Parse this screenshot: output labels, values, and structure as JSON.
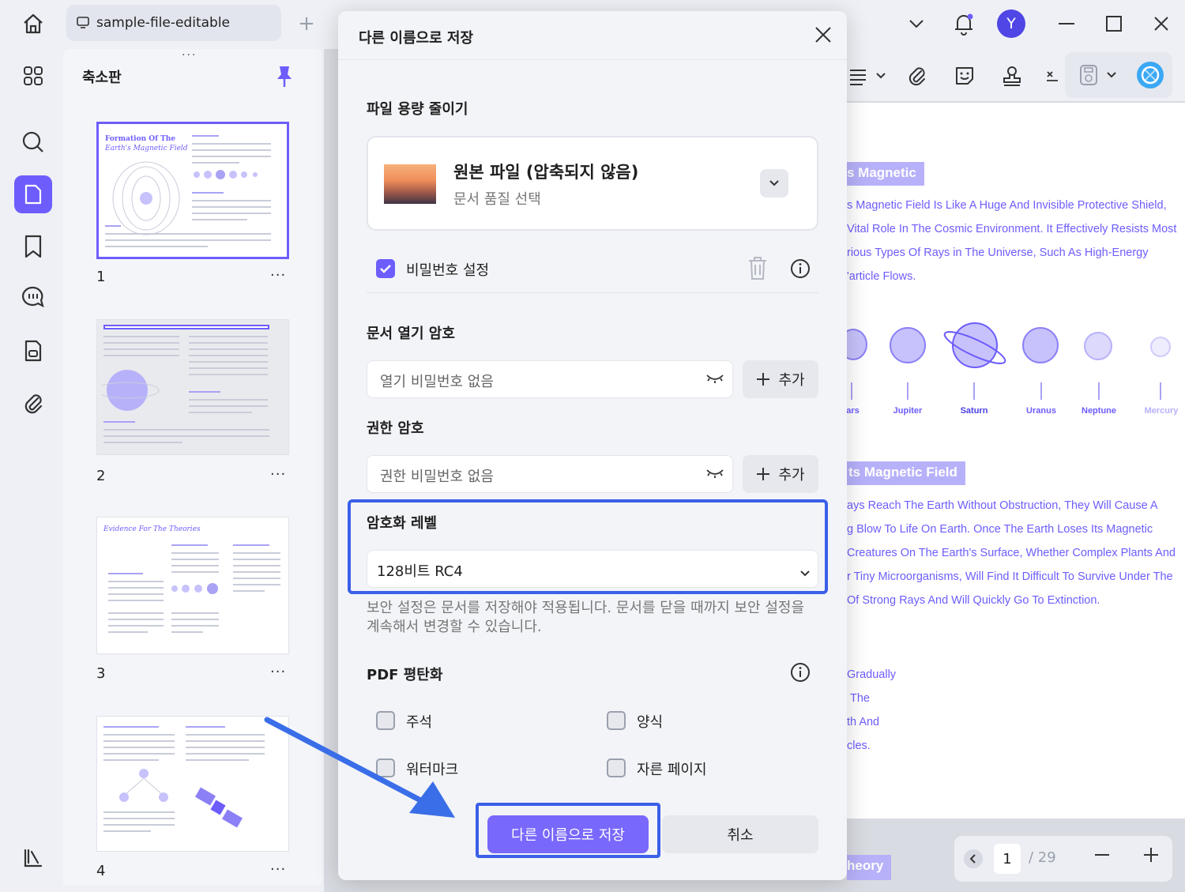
{
  "tab": {
    "title": "sample-file-editable"
  },
  "avatar_letter": "Y",
  "thumbnails": {
    "title": "축소판",
    "pages": [
      {
        "number": "1",
        "heading": "Formation Of The",
        "subheading": "Earth's Magnetic Field"
      },
      {
        "number": "2"
      },
      {
        "number": "3",
        "heading": "Evidence For The Theories"
      },
      {
        "number": "4"
      }
    ]
  },
  "document": {
    "heading1": "s Magnetic",
    "lines1": [
      "s Magnetic Field Is Like A Huge And Invisible Protective Shield,",
      "Vital Role In The Cosmic Environment. It Effectively Resists Most",
      "rious Types Of Rays in The Universe, Such As High-Energy",
      "'article Flows."
    ],
    "planets": [
      "lars",
      "Jupiter",
      "Saturn",
      "Uranus",
      "Neptune",
      "Mercury"
    ],
    "heading2": "ts Magnetic Field",
    "lines2": [
      "ays Reach The Earth Without Obstruction, They Will Cause A",
      "g Blow To Life On Earth. Once The Earth Loses Its Magnetic",
      "Creatures On The Earth's Surface, Whether Complex Plants And",
      "r Tiny Microorganisms, Will Find It Difficult To Survive Under The",
      "Of Strong Rays And Will Quickly Go To Extinction."
    ],
    "lines3": [
      "Gradually",
      "The",
      "th And",
      "cles."
    ],
    "heading3": "heory"
  },
  "pager": {
    "current": "1",
    "total": "/ 29"
  },
  "dialog": {
    "title": "다른 이름으로 저장",
    "reduce_title": "파일 용량 줄이기",
    "file_option": {
      "name": "원본 파일 (압축되지 않음)",
      "sub": "문서 품질 선택"
    },
    "password_label": "비밀번호 설정",
    "open_pw": {
      "title": "문서 열기 암호",
      "value": "열기 비밀번호 없음",
      "add": "추가"
    },
    "perm_pw": {
      "title": "권한 암호",
      "value": "권한 비밀번호 없음",
      "add": "추가"
    },
    "encryption": {
      "title": "암호화 레벨",
      "value": "128비트 RC4"
    },
    "note": "보안 설정은 문서를 저장해야 적용됩니다. 문서를 닫을 때까지 보안 설정을 계속해서 변경할 수 있습니다.",
    "flatten": {
      "title": "PDF 평탄화",
      "options": [
        "주석",
        "양식",
        "워터마크",
        "자른 페이지"
      ]
    },
    "save_label": "다른 이름으로 저장",
    "cancel_label": "취소"
  },
  "colors": {
    "accent": "#6d5dfc",
    "highlight": "#3a5fe8",
    "arrow": "#3a6ee8"
  }
}
